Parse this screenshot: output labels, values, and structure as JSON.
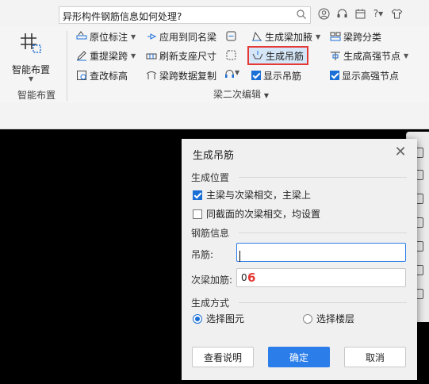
{
  "topbar": {
    "search_text": "异形构件钢筋信息如何处理?"
  },
  "ribbon": {
    "smart_layout": {
      "label": "智能布置",
      "group_label": "智能布置"
    },
    "group_label": "梁二次编辑",
    "col1": {
      "original_annotation": "原位标注",
      "relift_span": "重提梁跨",
      "check_elevation": "查改标高"
    },
    "col2": {
      "apply_same_name": "应用到同名梁",
      "refresh_support": "刷新支座尺寸",
      "span_copy": "梁跨数据复制"
    },
    "col3": {
      "gen_haunch": "生成梁加腋",
      "gen_hanger": "生成吊筋",
      "show_hanger": "显示吊筋"
    },
    "col4": {
      "span_classify": "梁跨分类",
      "gen_high_node": "生成高强节点",
      "show_high_node": "显示高强节点"
    }
  },
  "dialog": {
    "title": "生成吊筋",
    "position_section": "生成位置",
    "opt_main_secondary": "主梁与次梁相交，主梁上",
    "opt_same_section": "同截面的次梁相交，均设置",
    "rebar_section": "钢筋信息",
    "hanger_label": "吊筋:",
    "hanger_value": "",
    "secondary_label": "次梁加筋:",
    "secondary_value": "0",
    "annotation": "6",
    "method_section": "生成方式",
    "radio_select_element": "选择图元",
    "radio_select_floor": "选择楼层",
    "btn_help": "查看说明",
    "btn_ok": "确定",
    "btn_cancel": "取消"
  },
  "colors": {
    "accent": "#2b7de9",
    "highlight_border": "#e53935",
    "canvas": "#000000"
  }
}
